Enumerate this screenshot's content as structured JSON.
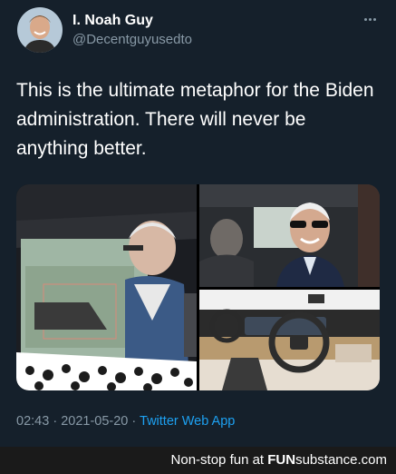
{
  "user": {
    "display_name": "I. Noah Guy",
    "handle": "@Decentguyusedto"
  },
  "tweet": {
    "text": "This is the ultimate metaphor for the Biden administration. There will never be anything better."
  },
  "media": {
    "image_count": 3
  },
  "meta": {
    "time": "02:43",
    "separator1": "·",
    "date": "2021-05-20",
    "separator2": "·",
    "app": "Twitter Web App"
  },
  "footer": {
    "prefix": "Non-stop fun at",
    "brand_fun": "FUN",
    "brand_substance": "substance",
    "brand_suffix": ".com"
  },
  "colors": {
    "background": "#15202b",
    "secondary_text": "#8899a6",
    "link": "#1da1f2",
    "footer_bg": "#1a1a1a"
  }
}
